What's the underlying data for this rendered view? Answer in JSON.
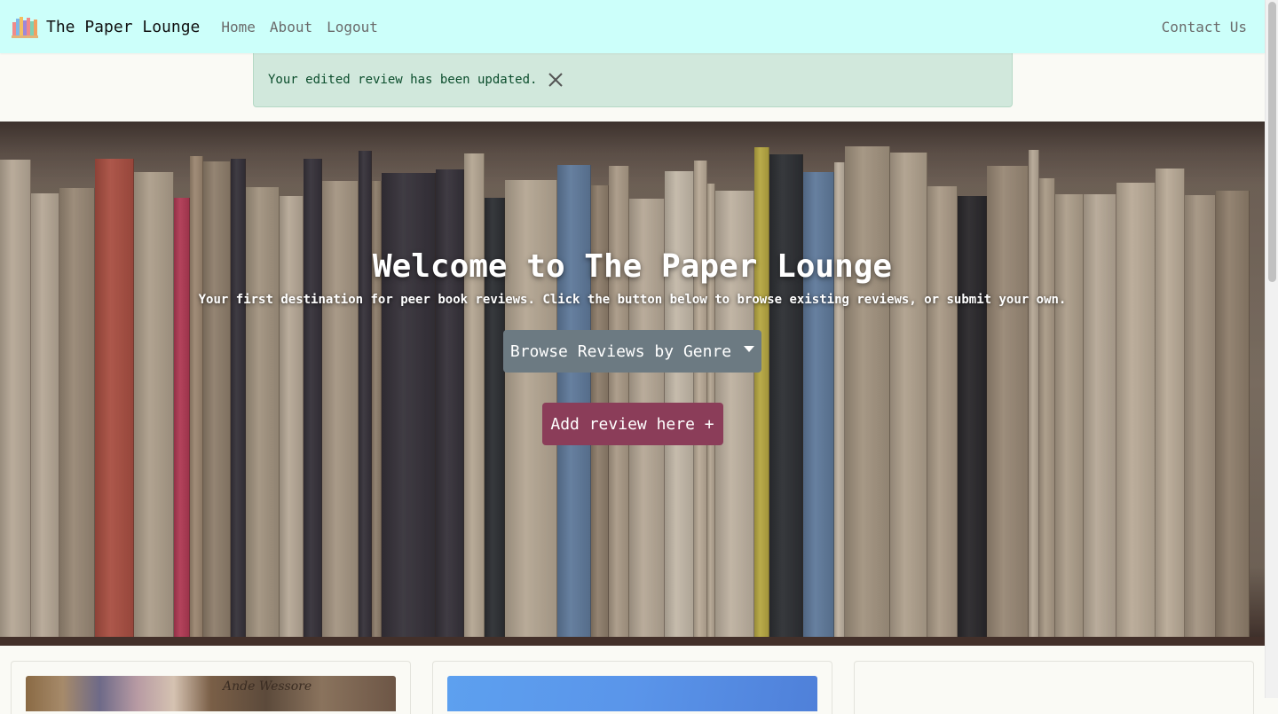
{
  "nav": {
    "brand": "The Paper Lounge",
    "links": [
      "Home",
      "About",
      "Logout"
    ],
    "contact": "Contact Us",
    "brand_icon": "bookshelf-icon"
  },
  "alert": {
    "message": "Your edited review has been updated.",
    "close_icon": "close-icon"
  },
  "hero": {
    "title": "Welcome to The Paper Lounge",
    "subtitle": "Your first destination for peer book reviews. Click the button below to browse existing reviews, or submit your own.",
    "genre_button": "Browse Reviews by Genre",
    "add_button": "Add review here +"
  },
  "cards": {
    "first_image_text": "Ande Wessore"
  },
  "colors": {
    "navbar": "#ccfffa",
    "alert_bg": "#d1e8dc",
    "alert_text": "#0b4d2c",
    "genre_button": "#6c7a82",
    "add_button": "#8b3d59",
    "page_bg": "#fafaf5"
  }
}
